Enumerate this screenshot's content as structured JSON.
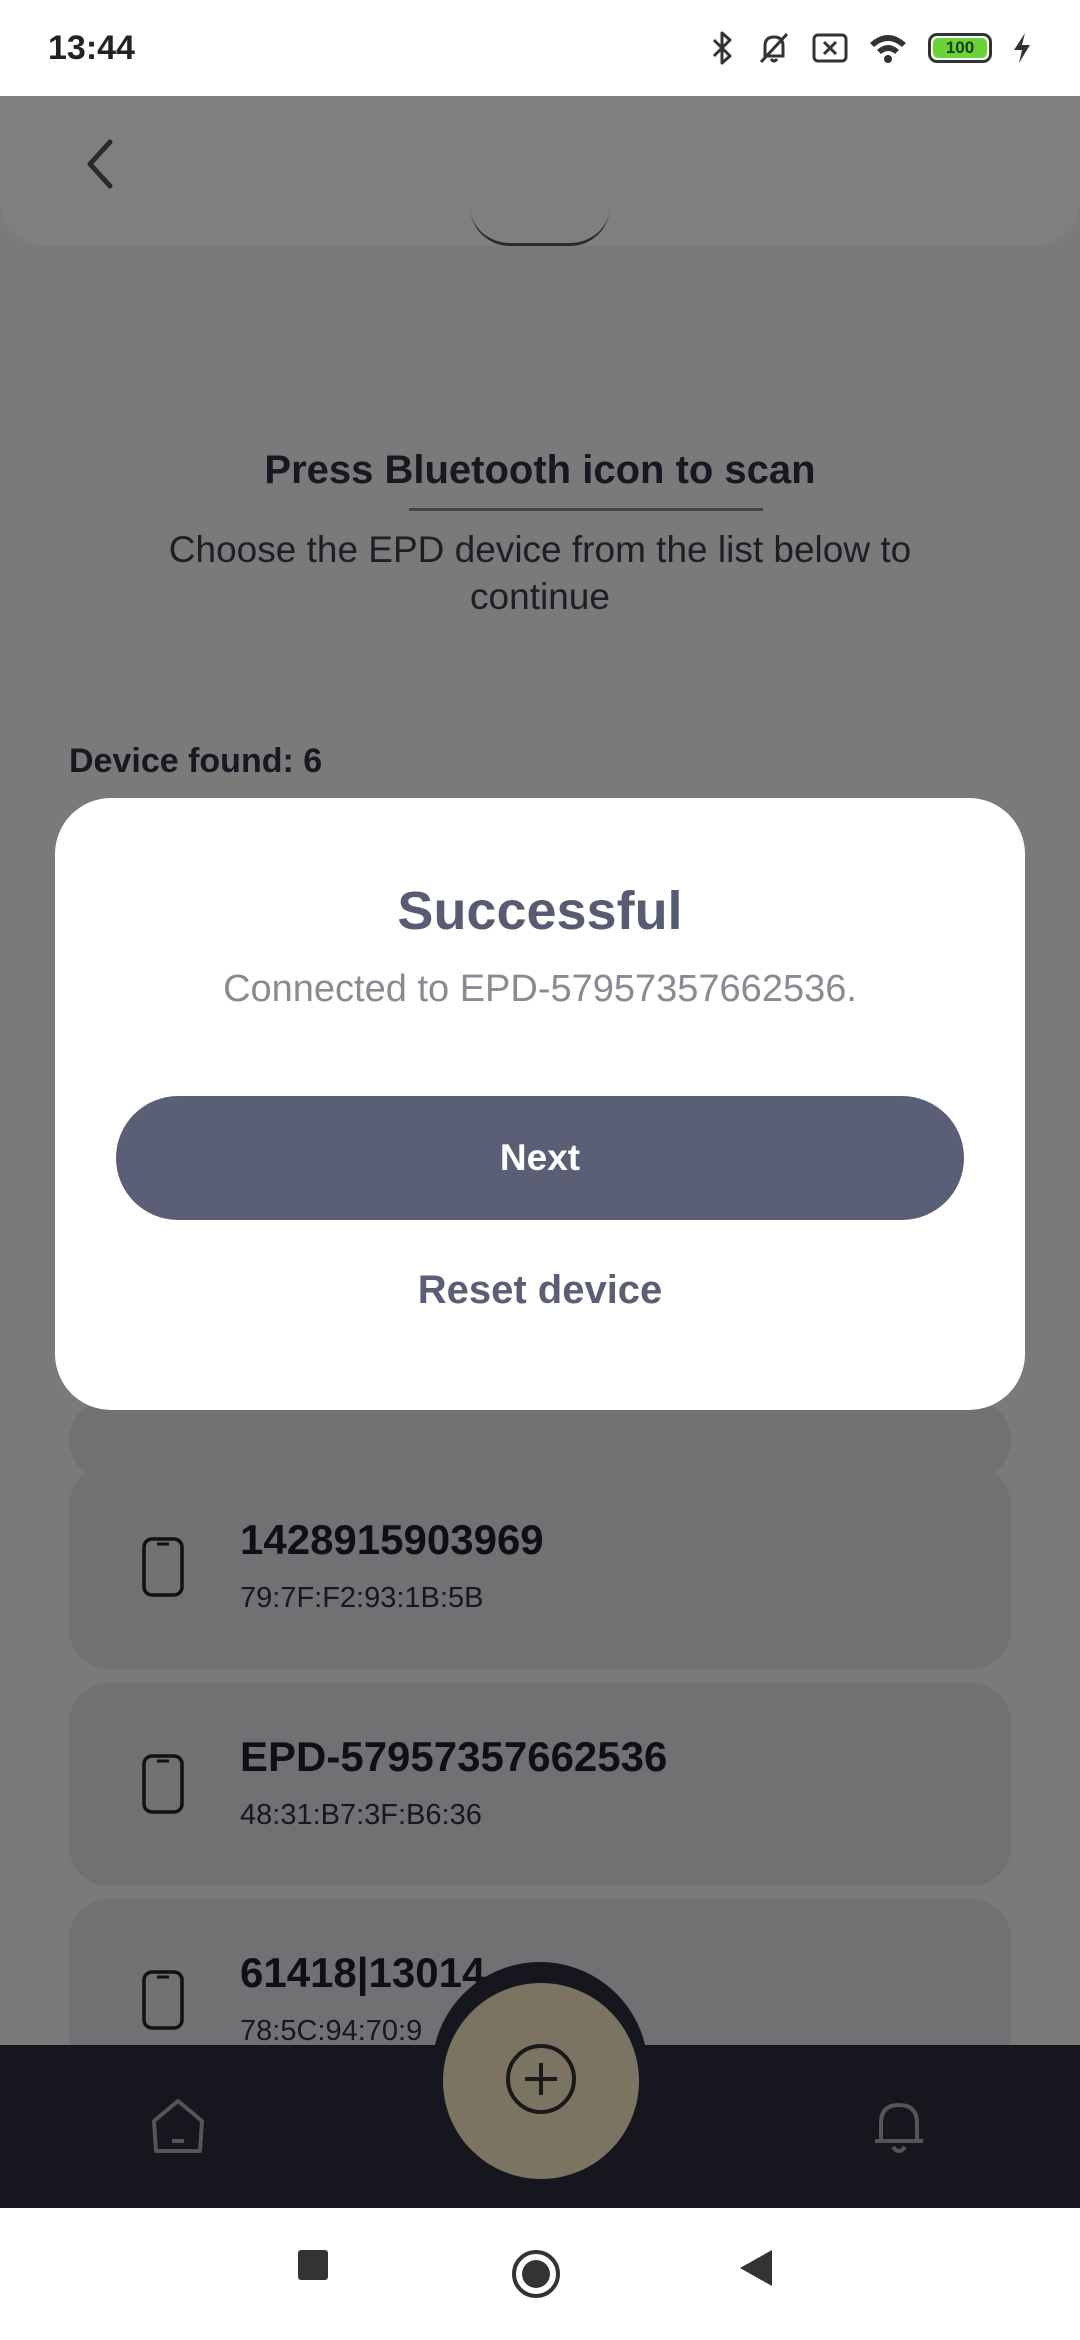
{
  "status_bar": {
    "time": "13:44",
    "battery_level": "100",
    "icons": [
      "bluetooth-icon",
      "bell-muted-icon",
      "sim-x-icon",
      "wifi-icon",
      "battery-icon",
      "charging-icon"
    ]
  },
  "header": {
    "back_icon": "chevron-left-icon"
  },
  "instructions": {
    "title": "Press Bluetooth icon to scan",
    "text": "Choose the EPD device from the list below to continue"
  },
  "devices": {
    "found_label": "Device found: 6",
    "items": [
      {
        "name": "1428915903969",
        "mac": "79:7F:F2:93:1B:5B"
      },
      {
        "name": "EPD-57957357662536",
        "mac": "48:31:B7:3F:B6:36"
      },
      {
        "name": "61418|13014",
        "mac": "78:5C:94:70:9"
      }
    ]
  },
  "dialog": {
    "title": "Successful",
    "message": "Connected to EPD-57957357662536.",
    "next_label": "Next",
    "reset_label": "Reset device"
  },
  "bottom_nav": {
    "items": [
      "home-icon",
      "add-circle-icon",
      "bell-icon"
    ]
  },
  "system_nav": {
    "items": [
      "recents-square-icon",
      "home-circle-icon",
      "back-triangle-icon"
    ]
  },
  "colors": {
    "primary": "#5b5f76",
    "fab": "#f9e8c6",
    "nav_bg": "#2b2c3c",
    "battery": "#6bd33a"
  }
}
